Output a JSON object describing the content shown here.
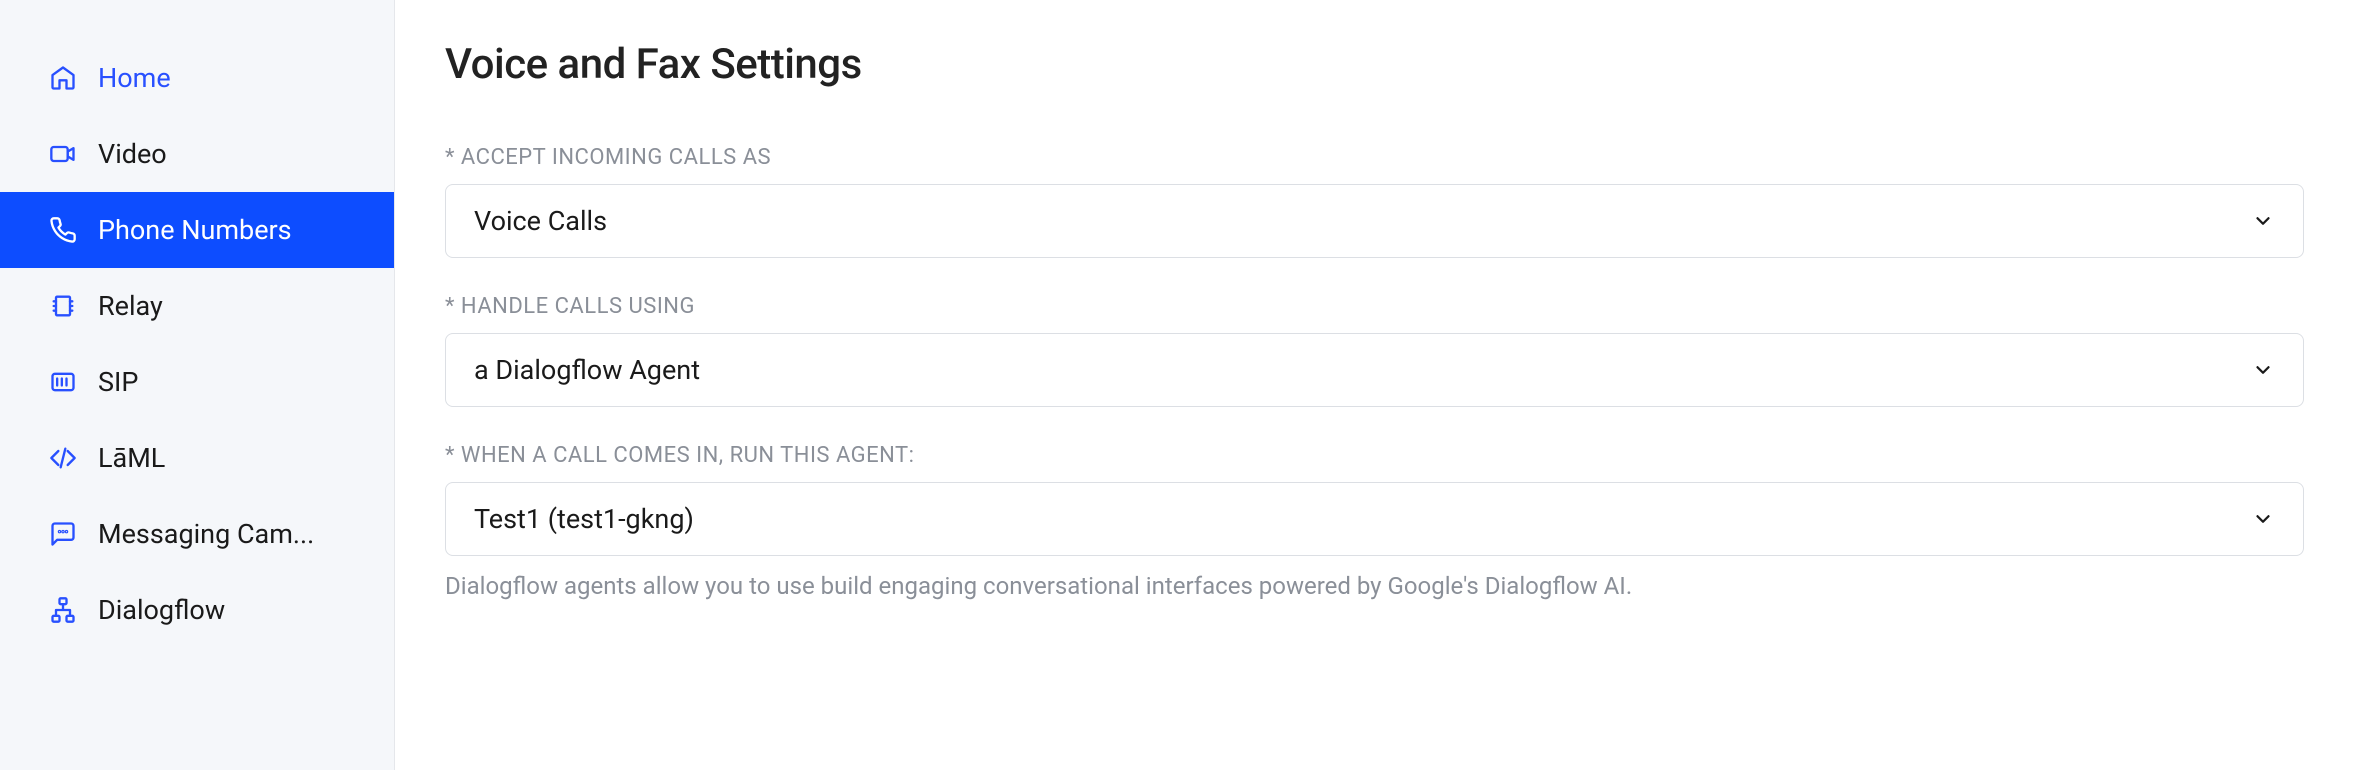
{
  "sidebar": {
    "items": [
      {
        "label": "Home",
        "icon": "home-icon",
        "active": false,
        "accent": true
      },
      {
        "label": "Video",
        "icon": "video-icon",
        "active": false
      },
      {
        "label": "Phone Numbers",
        "icon": "phone-icon",
        "active": true
      },
      {
        "label": "Relay",
        "icon": "relay-icon",
        "active": false
      },
      {
        "label": "SIP",
        "icon": "sip-icon",
        "active": false
      },
      {
        "label": "LāML",
        "icon": "code-icon",
        "active": false
      },
      {
        "label": "Messaging Cam...",
        "icon": "message-icon",
        "active": false
      },
      {
        "label": "Dialogflow",
        "icon": "network-icon",
        "active": false
      }
    ]
  },
  "main": {
    "title": "Voice and Fax Settings",
    "fields": [
      {
        "label": "* ACCEPT INCOMING CALLS AS",
        "value": "Voice Calls"
      },
      {
        "label": "* HANDLE CALLS USING",
        "value": "a Dialogflow Agent"
      },
      {
        "label": "* WHEN A CALL COMES IN, RUN THIS AGENT:",
        "value": "Test1 (test1-gkng)",
        "helper": "Dialogflow agents allow you to use build engaging conversational interfaces powered by Google's Dialogflow AI."
      }
    ]
  }
}
